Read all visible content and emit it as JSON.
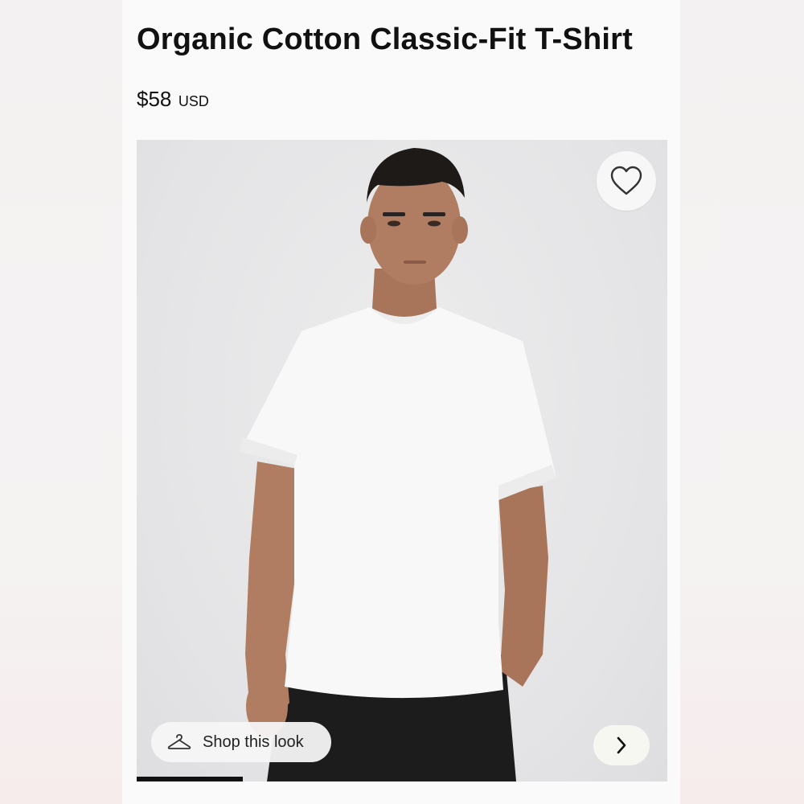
{
  "product": {
    "title": "Organic Cotton Classic-Fit T-Shirt",
    "price": "$58",
    "currency": "USD"
  },
  "gallery": {
    "wishlist_icon": "heart-icon",
    "shop_look_label": "Shop this look",
    "shop_look_icon": "hanger-icon",
    "next_icon": "chevron-right-icon",
    "progress": 0.2
  },
  "colors": {
    "text": "#111111",
    "image_background": "#e4e4e6",
    "shirt": "#f8f8f8",
    "pants": "#1c1c1c",
    "skin": "#b07d62",
    "hair": "#1e1a18"
  }
}
